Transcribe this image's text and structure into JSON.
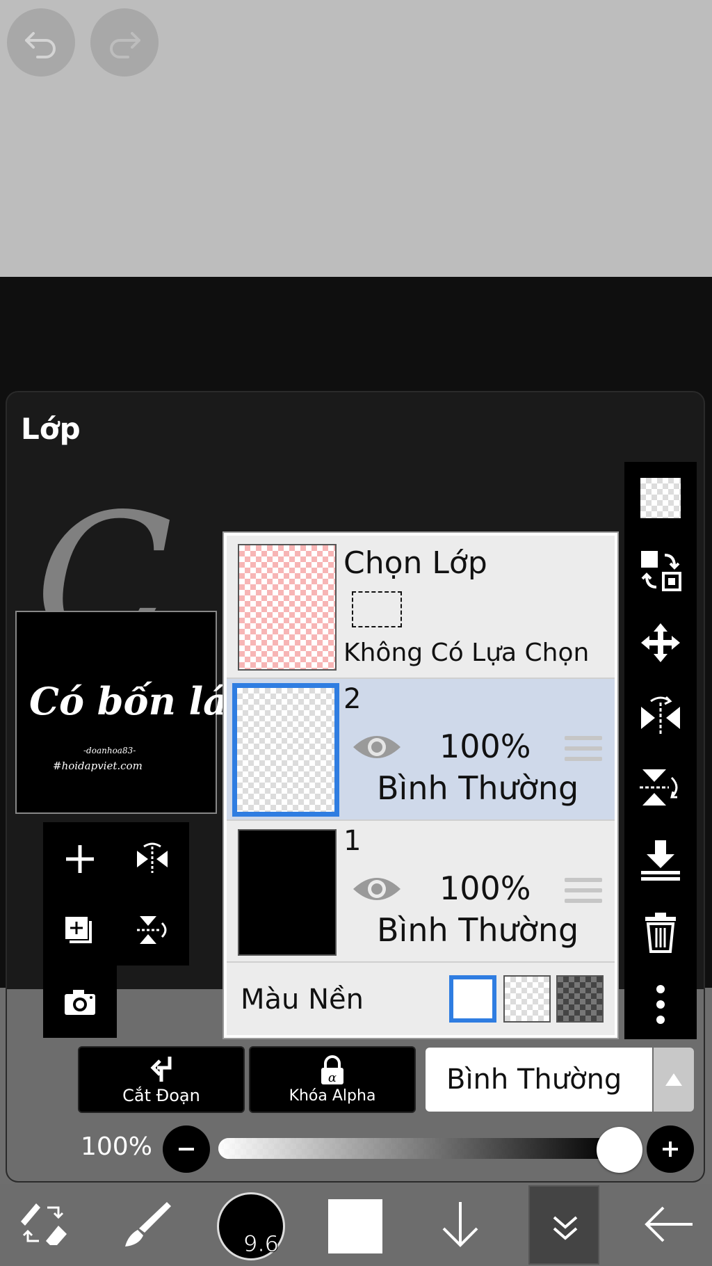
{
  "panel": {
    "title": "Lớp"
  },
  "canvas_preview": {
    "main_text": "Có bốn lá",
    "sub_text_1": "-doanhoa83-",
    "sub_text_2": "#hoidapviet.com"
  },
  "selection_layer": {
    "title": "Chọn Lớp",
    "status": "Không Có Lựa Chọn"
  },
  "layers": [
    {
      "number": "2",
      "opacity": "100%",
      "blend": "Bình Thường",
      "selected": true
    },
    {
      "number": "1",
      "opacity": "100%",
      "blend": "Bình Thường",
      "selected": false
    }
  ],
  "background": {
    "label": "Màu Nền",
    "options": [
      "white",
      "transparent",
      "dark-checker"
    ],
    "selected": "white"
  },
  "actions": {
    "clip_label": "Cắt Đoạn",
    "alpha_lock_label": "Khóa Alpha",
    "blend_mode": "Bình Thường"
  },
  "opacity_slider": {
    "label": "100%",
    "value": 1.0
  },
  "toolbar": {
    "brush_size": "9.6",
    "current_color": "#ffffff"
  },
  "colors": {
    "accent": "#2f7de1",
    "selected_row": "#cfd9ea"
  }
}
